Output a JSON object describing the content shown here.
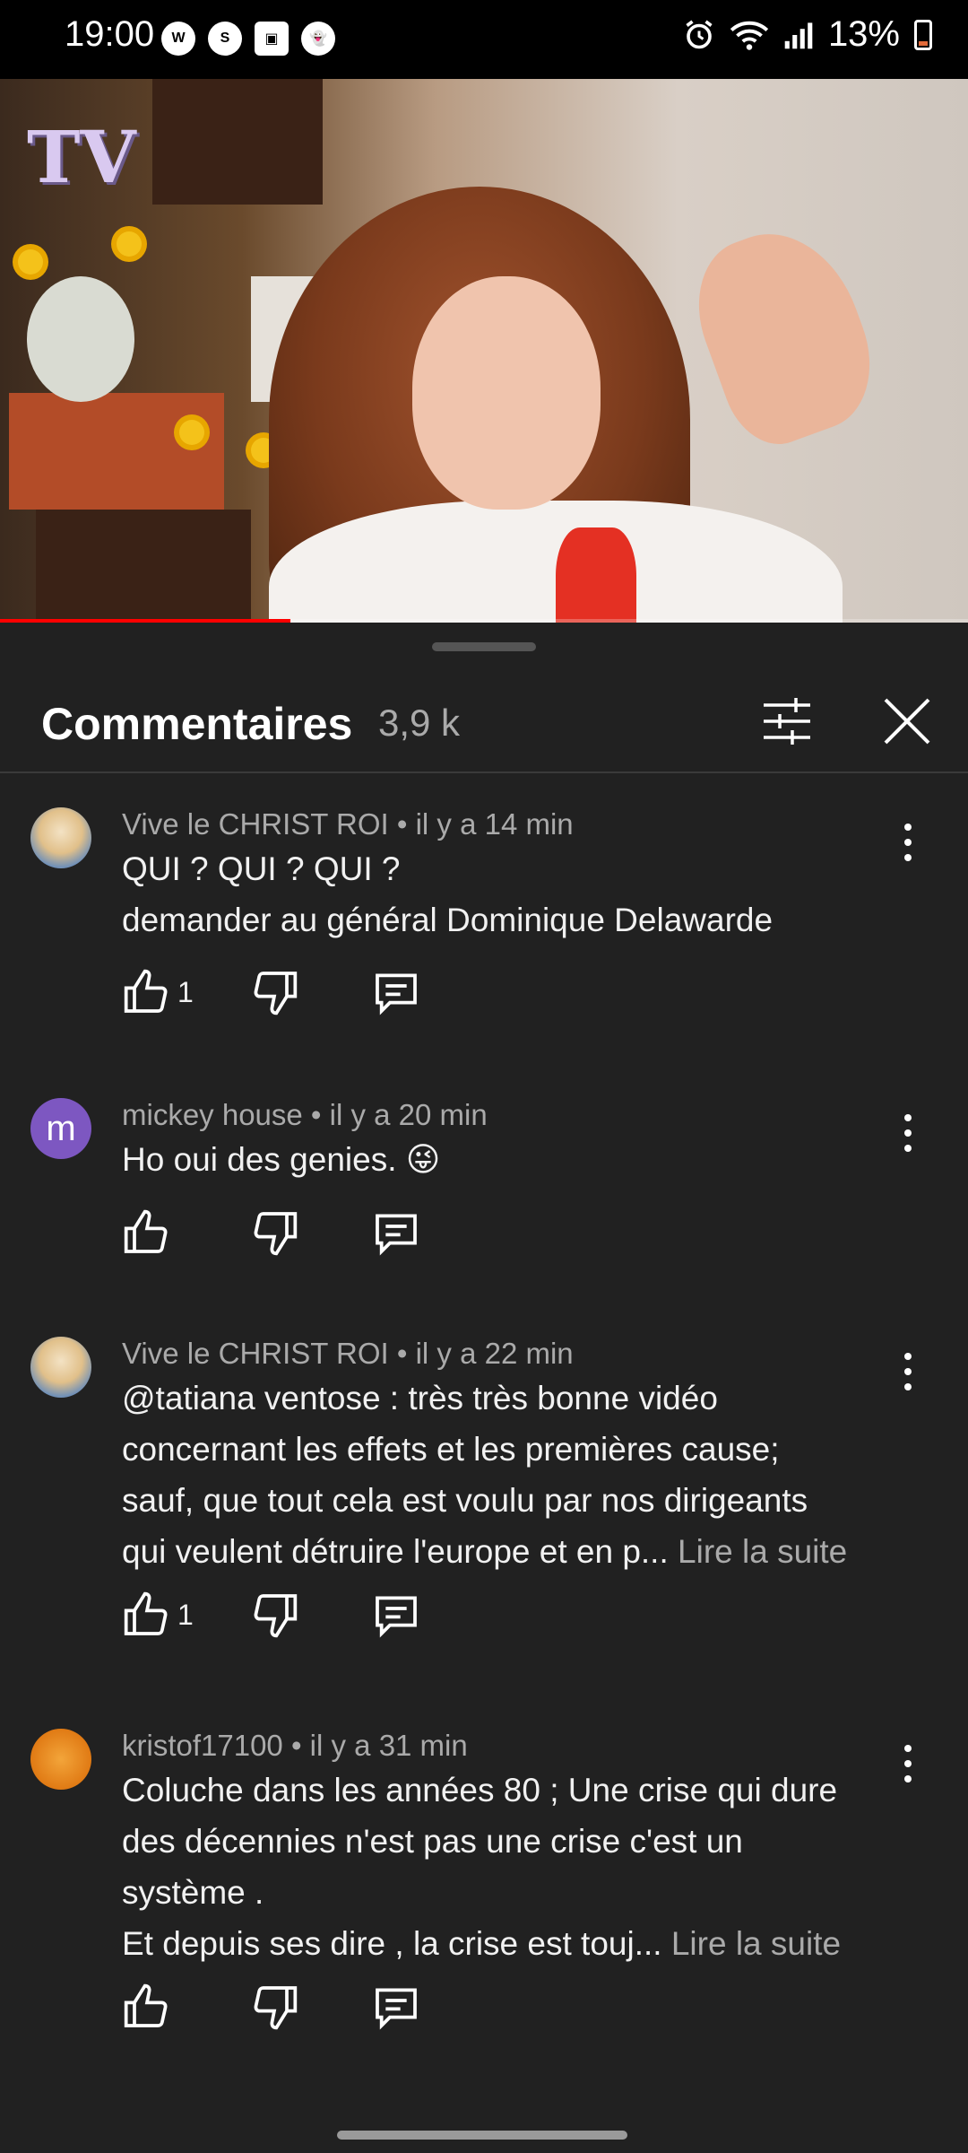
{
  "status_bar": {
    "time": "19:00",
    "left_icons": [
      "wecu-icon",
      "shazam-icon",
      "gallery-icon",
      "snapchat-icon"
    ],
    "battery": "13%"
  },
  "video": {
    "channel_logo_text": "TV",
    "progress": 0.3
  },
  "comments_panel": {
    "title": "Commentaires",
    "count": "3,9 k",
    "comments": [
      {
        "author": "Vive le CHRIST ROI",
        "time": "il y a 14 min",
        "meta": "Vive le CHRIST ROI • il y a 14 min",
        "text_lines": [
          "QUI ? QUI ? QUI ?",
          "demander au général Dominique Delawarde"
        ],
        "likes": "1",
        "read_more": ""
      },
      {
        "author": "mickey house",
        "avatar_letter": "m",
        "meta": "mickey house • il y a 20 min",
        "text_lines": [
          "Ho oui des genies. 😜"
        ],
        "likes": "",
        "read_more": ""
      },
      {
        "author": "Vive le CHRIST ROI",
        "meta": "Vive le CHRIST ROI • il y a 22 min",
        "text_lines": [
          "@tatiana ventose  : très très bonne vidéo",
          "concernant les effets et les premières cause;",
          "sauf, que tout cela est voulu par nos dirigeants",
          "qui veulent détruire l'europe et en p..."
        ],
        "likes": "1",
        "read_more": "Lire la suite"
      },
      {
        "author": "kristof17100",
        "meta": "kristof17100 • il y a 31 min",
        "text_lines": [
          "Coluche dans les années 80 ; Une crise qui dure",
          "des décennies n'est pas une crise c'est un",
          "système .",
          "Et depuis ses dire , la crise est touj..."
        ],
        "likes": "",
        "read_more": "Lire la suite"
      }
    ]
  },
  "colors": {
    "panel_bg": "#212121",
    "progress_red": "#ff0000",
    "secondary_text": "#aaaaaa"
  }
}
